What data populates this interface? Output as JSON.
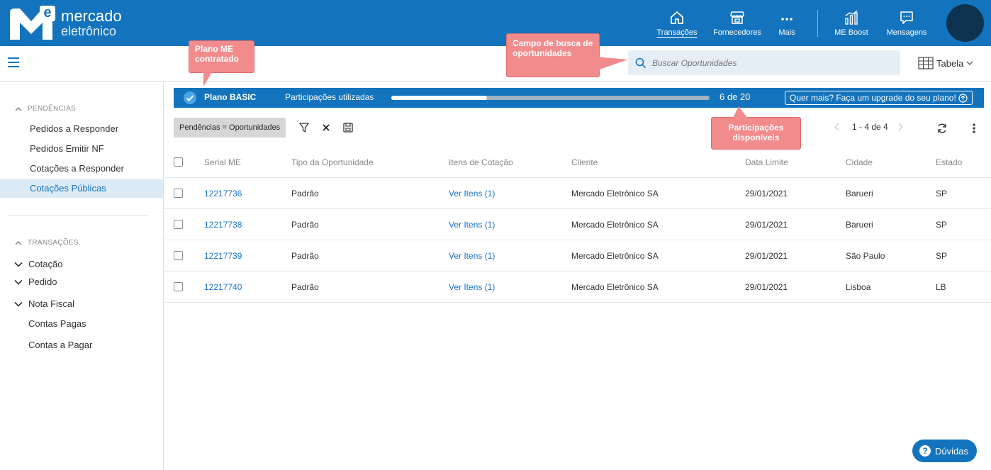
{
  "header": {
    "logo_line1": "mercado",
    "logo_line2": "eletrônico",
    "logo_badge": "e",
    "nav": [
      {
        "label": "Transações",
        "icon": "home-icon"
      },
      {
        "label": "Fornecedores",
        "icon": "store-icon"
      },
      {
        "label": "Mais",
        "icon": "more-icon"
      },
      {
        "label": "ME Boost",
        "icon": "chart-icon"
      },
      {
        "label": "Mensagens",
        "icon": "message-icon"
      }
    ]
  },
  "subbar": {
    "search_placeholder": "Buscar Oportunidades",
    "view_label": "Tabela"
  },
  "callouts": {
    "plan": "Plano ME contratado",
    "search": "Campo de busca de oportunidades",
    "participations": "Participações disponíveis"
  },
  "sidebar": {
    "pending_header": "PENDÊNCIAS",
    "pending_items": [
      "Pedidos a Responder",
      "Pedidos Emitir NF",
      "Cotações a Responder",
      "Cotações Públicas"
    ],
    "transactions_header": "TRANSAÇÕES",
    "transactions_expandable": [
      "Cotação",
      "Pedido",
      "Nota Fiscal"
    ],
    "transactions_items": [
      "Contas Pagas",
      "Contas a Pagar"
    ]
  },
  "plan": {
    "name": "Plano BASIC",
    "used_label": "Participações utilizadas",
    "used": 6,
    "total": 20,
    "count_text": "6 de 20",
    "upgrade_label": "Quer mais? Faça um upgrade do seu plano!"
  },
  "filters": {
    "chip": "Pendências = Oportunidades",
    "pager": "1 - 4 de 4"
  },
  "table": {
    "headers": [
      "Serial ME",
      "Tipo da Oportunidade",
      "Itens de Cotação",
      "Cliente",
      "Data Limite",
      "Cidade",
      "Estado"
    ],
    "rows": [
      {
        "serial": "12217736",
        "tipo": "Padrão",
        "itens": "Ver Itens (1)",
        "cliente": "Mercado Eletrônico SA",
        "data": "29/01/2021",
        "cidade": "Barueri",
        "estado": "SP"
      },
      {
        "serial": "12217738",
        "tipo": "Padrão",
        "itens": "Ver Itens (1)",
        "cliente": "Mercado Eletrônico SA",
        "data": "29/01/2021",
        "cidade": "Barueri",
        "estado": "SP"
      },
      {
        "serial": "12217739",
        "tipo": "Padrão",
        "itens": "Ver Itens (1)",
        "cliente": "Mercado Eletrônico SA",
        "data": "29/01/2021",
        "cidade": "São Paulo",
        "estado": "SP"
      },
      {
        "serial": "12217740",
        "tipo": "Padrão",
        "itens": "Ver Itens (1)",
        "cliente": "Mercado Eletrônico SA",
        "data": "29/01/2021",
        "cidade": "Lisboa",
        "estado": "LB"
      }
    ]
  },
  "help_label": "Dúvidas",
  "colors": {
    "brand": "#1373bc",
    "callout": "#f28b8b",
    "link": "#1a73c7"
  }
}
